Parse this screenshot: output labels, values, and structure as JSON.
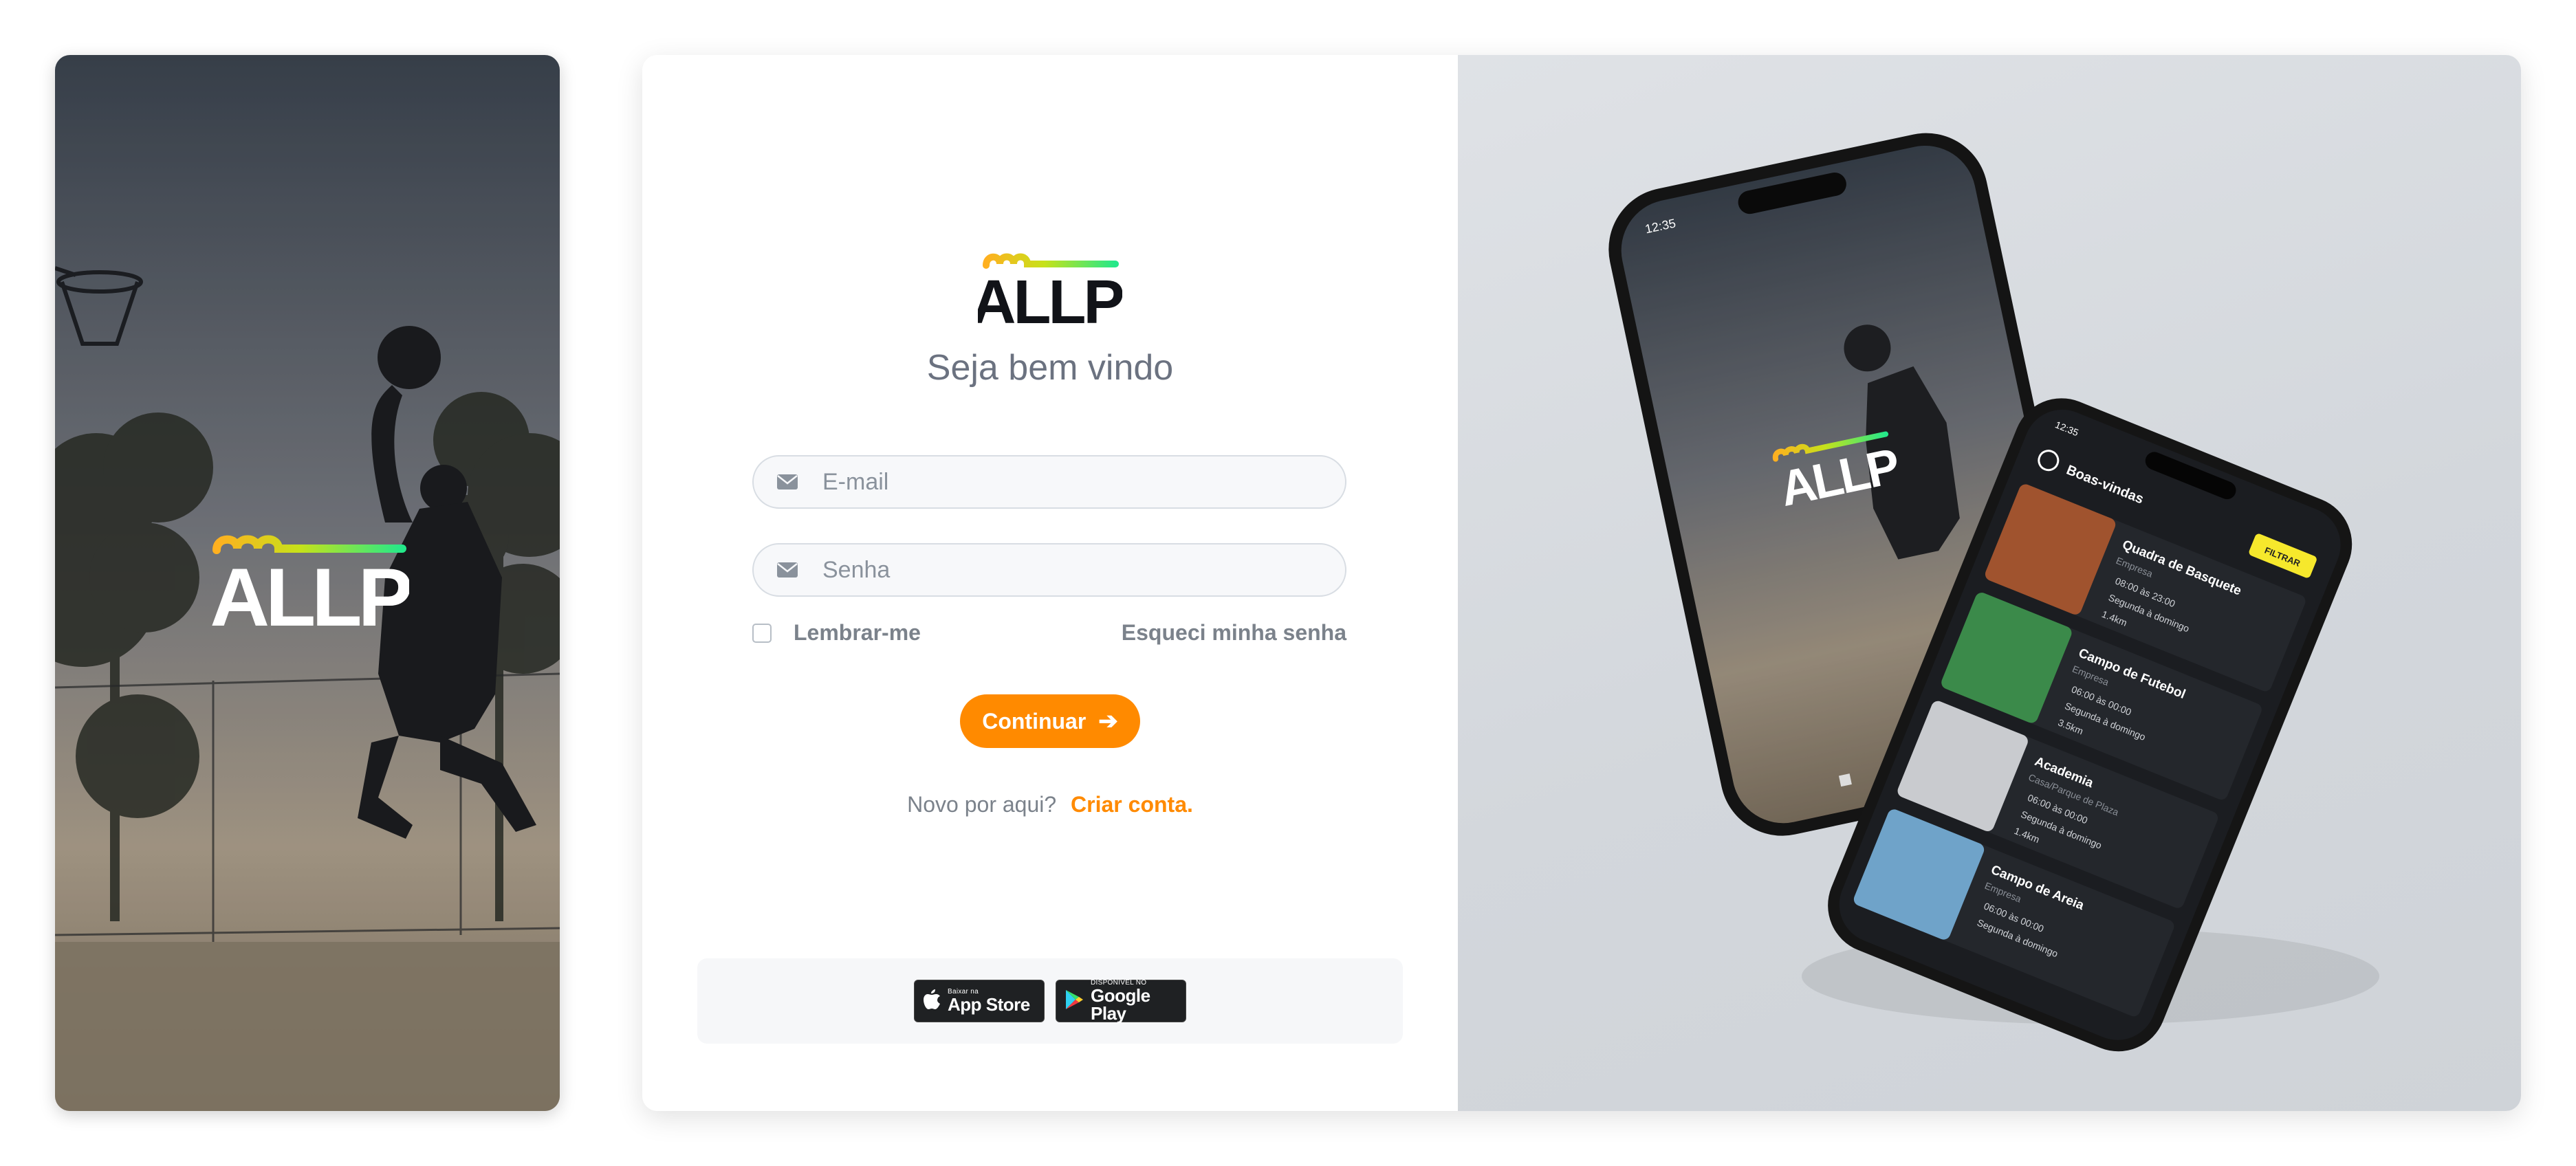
{
  "brand": {
    "name": "ALLP",
    "accent_orange": "#ff8a00",
    "gradient": [
      "#ffb020",
      "#c6e21a",
      "#24e88a"
    ]
  },
  "login": {
    "welcome": "Seja bem vindo",
    "email_placeholder": "E-mail",
    "password_placeholder": "Senha",
    "remember_label": "Lembrar-me",
    "forgot_label": "Esqueci minha senha",
    "continue_label": "Continuar",
    "signup_prompt": "Novo por aqui?",
    "signup_link": "Criar conta."
  },
  "stores": {
    "appstore_small": "Baixar na",
    "appstore_big": "App Store",
    "googleplay_small": "DISPONÍVEL NO",
    "googleplay_big": "Google Play"
  },
  "phone_back": {
    "time": "12:35"
  },
  "phone_front": {
    "time": "12:35",
    "header": "Boas-vindas",
    "filter_label": "FILTRAR",
    "items": [
      {
        "title": "Quadra de Basquete",
        "subtitle": "Empresa",
        "hours": "08:00 às 23:00",
        "days": "Segunda à domingo",
        "distance": "1.4km"
      },
      {
        "title": "Campo de Futebol",
        "subtitle": "Empresa",
        "hours": "06:00 às 00:00",
        "days": "Segunda à domingo",
        "distance": "3.5km"
      },
      {
        "title": "Academia",
        "subtitle": "Casa/Parque de Plaza",
        "hours": "06:00 às 00:00",
        "days": "Segunda à domingo",
        "distance": "1.4km"
      },
      {
        "title": "Campo de Areia",
        "subtitle": "Empresa",
        "hours": "06:00 às 00:00",
        "days": "Segunda à domingo",
        "distance": ""
      }
    ]
  }
}
